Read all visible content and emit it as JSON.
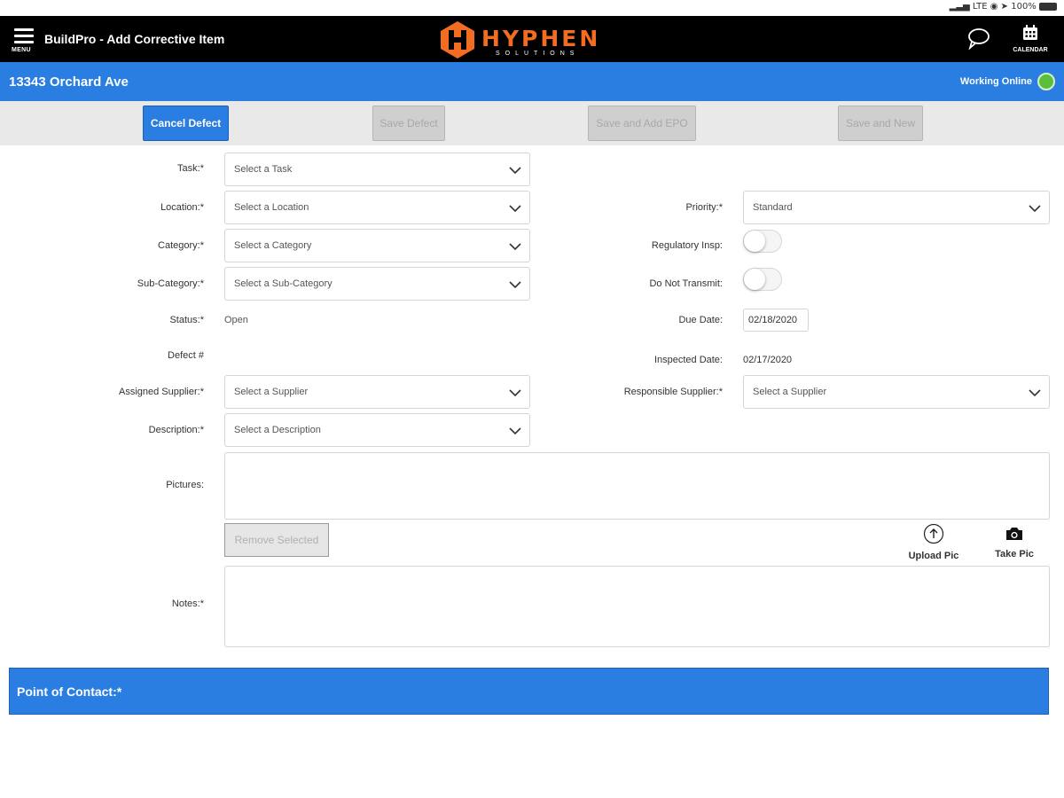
{
  "status": {
    "signal": "LTE",
    "battery": "100%"
  },
  "header": {
    "menu_label": "MENU",
    "title": "BuildPro - Add  Corrective Item",
    "logo_text": "HYPHEN",
    "logo_sub": "SOLUTIONS",
    "calendar_label": "CALENDAR"
  },
  "job": {
    "address": "13343 Orchard Ave",
    "connection": "Working Online",
    "status_color": "#5bbf3c"
  },
  "actions": {
    "cancel": "Cancel Defect",
    "save": "Save Defect",
    "save_add_epo": "Save and Add EPO",
    "save_new": "Save and New"
  },
  "form": {
    "task": {
      "label": "Task:*",
      "placeholder": "Select a Task"
    },
    "location": {
      "label": "Location:*",
      "placeholder": "Select a Location"
    },
    "category": {
      "label": "Category:*",
      "placeholder": "Select a Category"
    },
    "subcategory": {
      "label": "Sub-Category:*",
      "placeholder": "Select a Sub-Category"
    },
    "status": {
      "label": "Status:*",
      "value": "Open"
    },
    "defect": {
      "label": "Defect #",
      "value": ""
    },
    "assigned_supplier": {
      "label": "Assigned Supplier:*",
      "placeholder": "Select a Supplier"
    },
    "description": {
      "label": "Description:*",
      "placeholder": "Select a Description"
    },
    "pictures": {
      "label": "Pictures:"
    },
    "remove_selected": "Remove Selected",
    "upload_pic": "Upload Pic",
    "take_pic": "Take Pic",
    "notes": {
      "label": "Notes:*",
      "value": ""
    },
    "priority": {
      "label": "Priority:*",
      "value": "Standard"
    },
    "regulatory": {
      "label": "Regulatory Insp:",
      "on": false
    },
    "do_not_transmit": {
      "label": "Do Not Transmit:",
      "on": false
    },
    "due_date": {
      "label": "Due Date:",
      "value": "02/18/2020"
    },
    "inspected_date": {
      "label": "Inspected Date:",
      "value": "02/17/2020"
    },
    "responsible_supplier": {
      "label": "Responsible Supplier:*",
      "placeholder": "Select a Supplier"
    }
  },
  "point_of_contact": {
    "label": "Point of Contact:*"
  }
}
